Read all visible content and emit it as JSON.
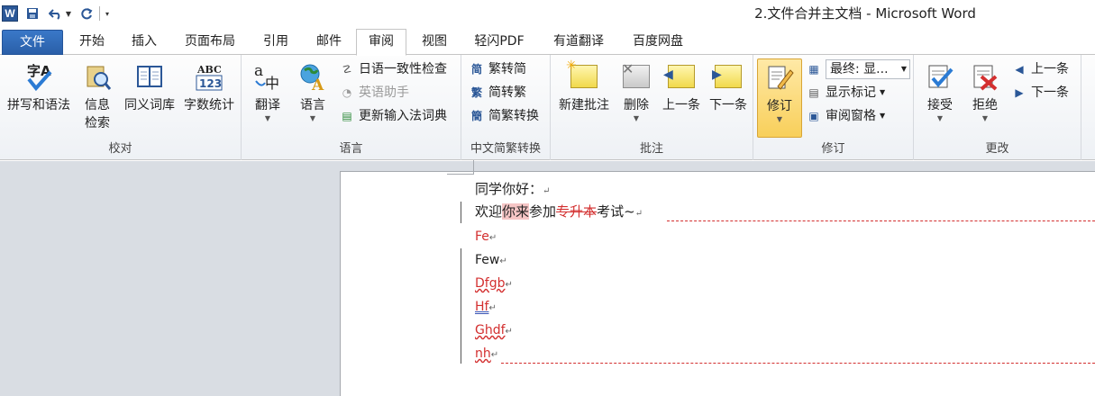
{
  "window": {
    "title": "2.文件合并主文档 - Microsoft Word"
  },
  "qat": {
    "logo": "W",
    "save_icon": "save-icon",
    "undo_icon": "undo-icon",
    "redo_icon": "redo-icon"
  },
  "tabs": [
    {
      "label": "文件"
    },
    {
      "label": "开始"
    },
    {
      "label": "插入"
    },
    {
      "label": "页面布局"
    },
    {
      "label": "引用"
    },
    {
      "label": "邮件"
    },
    {
      "label": "审阅"
    },
    {
      "label": "视图"
    },
    {
      "label": "轻闪PDF"
    },
    {
      "label": "有道翻译"
    },
    {
      "label": "百度网盘"
    }
  ],
  "ribbon": {
    "proofing": {
      "label": "校对",
      "spelling": "拼写和语法",
      "research1": "信息",
      "research2": "检索",
      "thesaurus": "同义词库",
      "wordcount": "字数统计",
      "abc_icon_text": "ABC",
      "num_icon_text": "123",
      "spell_icon_text": "字A"
    },
    "language": {
      "label": "语言",
      "translate": "翻译",
      "language": "语言",
      "jp_check": "日语一致性检查",
      "en_assist": "英语助手",
      "update_ime": "更新输入法词典"
    },
    "chinese": {
      "label": "中文简繁转换",
      "t2s": "繁转简",
      "s2t": "简转繁",
      "convert": "简繁转换"
    },
    "comments": {
      "label": "批注",
      "new": "新建批注",
      "delete": "删除",
      "prev": "上一条",
      "next": "下一条"
    },
    "tracking": {
      "label": "修订",
      "track": "修订",
      "display_select": "最终: 显...",
      "show_markup": "显示标记",
      "review_pane": "审阅窗格"
    },
    "changes": {
      "label": "更改",
      "accept": "接受",
      "reject": "拒绝",
      "prev": "上一条",
      "next": "下一条"
    }
  },
  "document": {
    "line1": "同学你好：",
    "line2_a": "欢迎",
    "line2_ins": "你来",
    "line2_b": "参加",
    "line2_del": "专升本",
    "line2_c": "考试~",
    "lines": [
      "Fe",
      "Few",
      "Dfgb",
      "Hf",
      "Ghdf",
      "nh"
    ],
    "para_mark": "↵"
  },
  "colors": {
    "accent": "#2b5797",
    "revision": "#d32f2f"
  }
}
